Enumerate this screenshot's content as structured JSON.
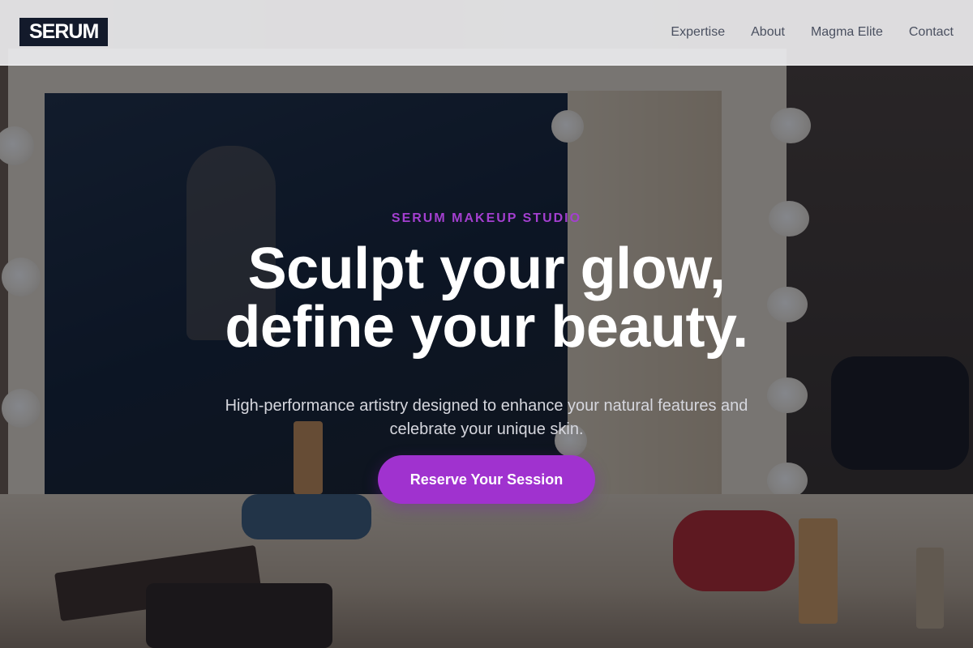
{
  "header": {
    "logo_text": "SERUM",
    "nav": [
      {
        "label": "Expertise"
      },
      {
        "label": "About"
      },
      {
        "label": "Magma Elite"
      },
      {
        "label": "Contact"
      }
    ]
  },
  "hero": {
    "eyebrow": "SERUM MAKEUP STUDIO",
    "headline_line1": "Sculpt your glow,",
    "headline_line2": "define your beauty.",
    "subtext": "High-performance artistry designed to enhance your natural features and celebrate your unique skin.",
    "cta_label": "Reserve Your Session"
  },
  "colors": {
    "accent": "#a032cf",
    "eyebrow": "#a43fd0",
    "logo_bg": "#131a2b",
    "nav_text": "#4a5060"
  }
}
